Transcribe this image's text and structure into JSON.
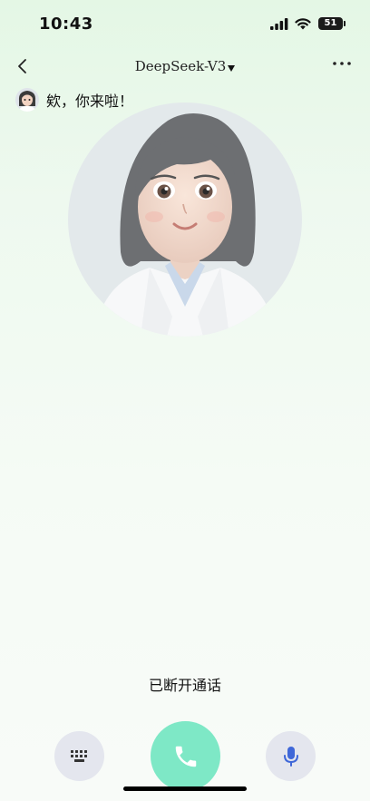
{
  "status_bar": {
    "time": "10:43",
    "battery": "51"
  },
  "nav": {
    "title": "DeepSeek-V3"
  },
  "greeting": {
    "text": "欸，你来啦！"
  },
  "call": {
    "status_text": "已断开通话"
  },
  "colors": {
    "call_button": "#7ee8c6",
    "mic_icon": "#3f67d8",
    "side_button_bg": "#e4e6ee"
  }
}
